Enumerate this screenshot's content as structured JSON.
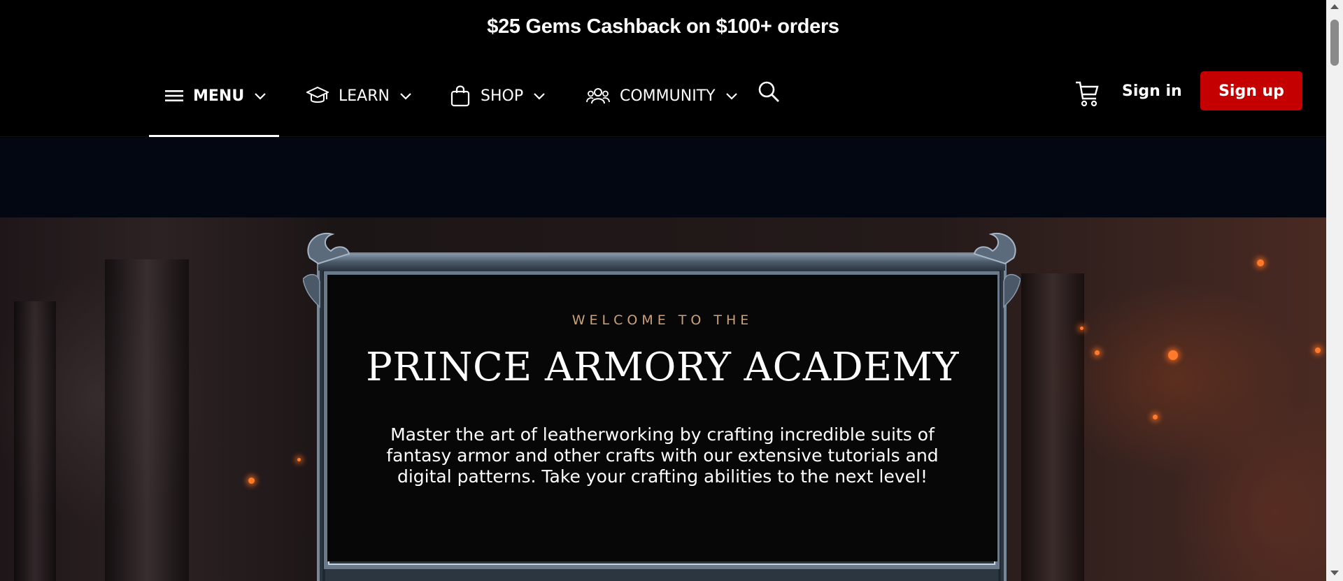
{
  "promo": {
    "text": "$25 Gems Cashback on $100+ orders"
  },
  "nav": {
    "menu_label": "MENU",
    "learn_label": "LEARN",
    "shop_label": "SHOP",
    "community_label": "COMMUNITY",
    "signin_label": "Sign in",
    "signup_label": "Sign up",
    "active_item": "MENU",
    "icons": [
      "hamburger-icon",
      "graduation-cap-icon",
      "shopping-bag-icon",
      "users-icon",
      "search-icon",
      "cart-icon",
      "chevron-down-icon"
    ]
  },
  "hero": {
    "eyebrow": "WELCOME TO THE",
    "title": "PRINCE ARMORY ACADEMY",
    "description": "Master the art of leatherworking by crafting incredible suits of fantasy armor and other crafts with our extensive tutorials and digital patterns. Take your crafting abilities to the next level!"
  },
  "colors": {
    "signup_bg": "#c40000",
    "eyebrow": "#c9a27a",
    "band": "#030711",
    "panel": "#080708",
    "frame": "#5f6f80"
  }
}
